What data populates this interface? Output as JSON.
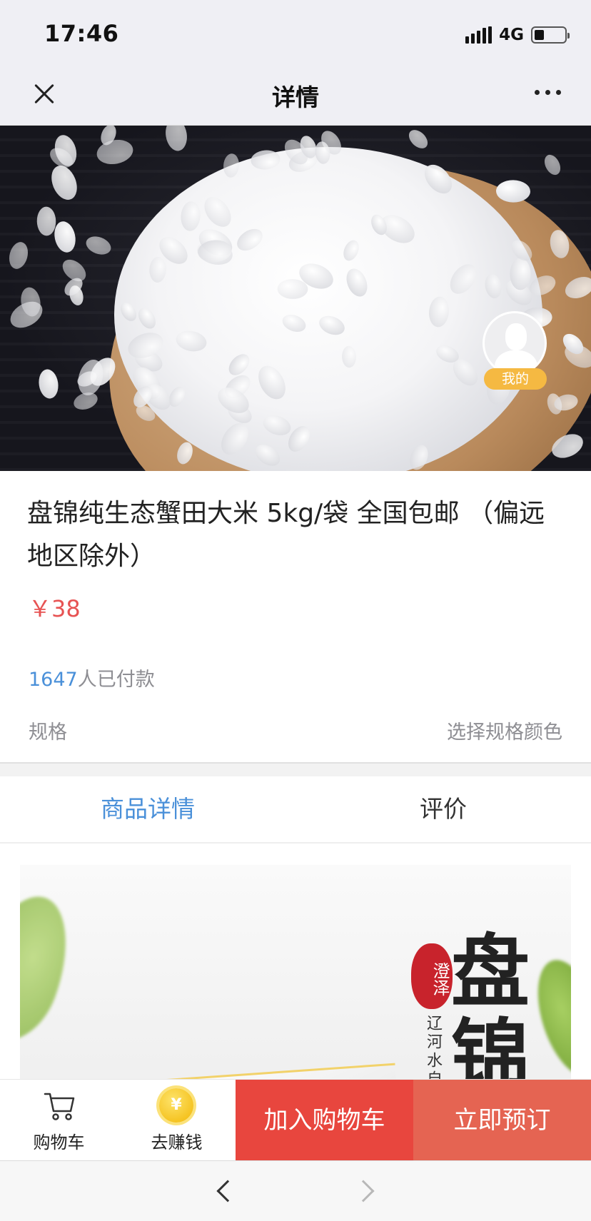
{
  "status": {
    "time": "17:46",
    "network": "4G",
    "battery_level": 0.3
  },
  "nav": {
    "title": "详情",
    "close_icon": "close-icon",
    "more_icon": "more-icon"
  },
  "hero": {
    "slide_count": 5,
    "active_slide": 2
  },
  "floating": {
    "label": "我的"
  },
  "product": {
    "title": "盘锦纯生态蟹田大米 5kg/袋 全国包邮 （偏远地区除外）",
    "price": "￥38",
    "paid_count": "1647",
    "paid_suffix": "人已付款",
    "spec_label": "规格",
    "spec_value": "选择规格颜色"
  },
  "tabs": [
    {
      "label": "商品详情",
      "active": true
    },
    {
      "label": "评价",
      "active": false
    }
  ],
  "detail_image": {
    "seal_text": "澄泽",
    "big_chars": [
      "盘",
      "锦"
    ],
    "vertical_text": "辽河水自流"
  },
  "bottom_bar": {
    "cart_label": "购物车",
    "earn_label": "去赚钱",
    "coin_symbol": "¥",
    "add_to_cart": "加入购物车",
    "order_now": "立即预订"
  },
  "colors": {
    "accent_blue": "#4a90d9",
    "price_red": "#e75353",
    "cart_button": "#e8463e",
    "order_button": "#e56452",
    "dot_active": "#f6a623"
  }
}
